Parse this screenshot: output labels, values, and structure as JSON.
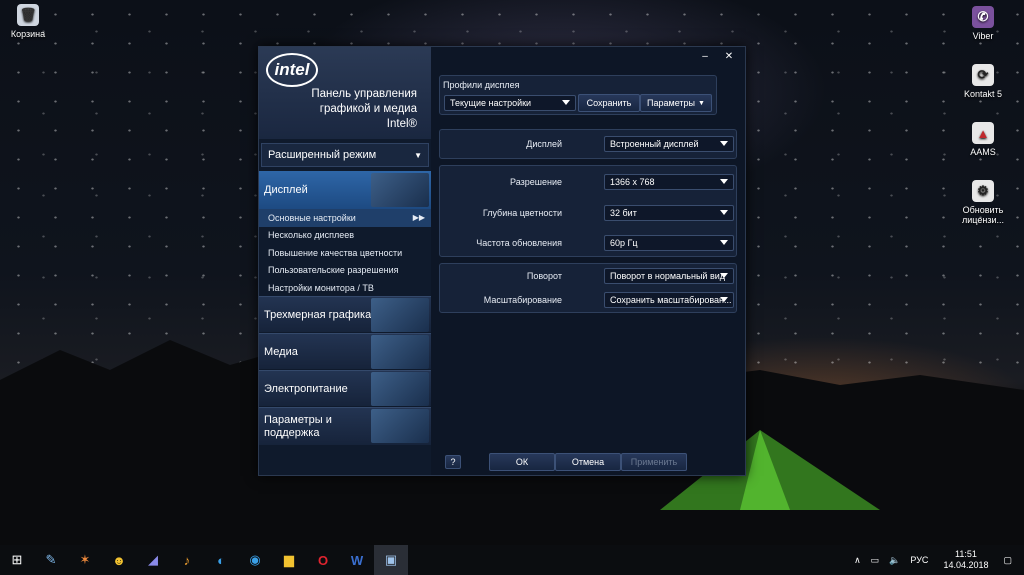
{
  "desktop": {
    "icons_left": [
      {
        "label": "Корзина",
        "icon": "recycle-bin-icon"
      }
    ],
    "icons_right": [
      {
        "label": "Viber",
        "icon": "viber-icon"
      },
      {
        "label": "Kontakt 5",
        "icon": "kontakt-icon"
      },
      {
        "label": "AAMS",
        "icon": "aams-icon"
      },
      {
        "label_line1": "Обновить",
        "label_line2": "лицензи...",
        "icon": "update-license-icon"
      }
    ]
  },
  "window": {
    "logo": "intel",
    "title_line1": "Панель управления",
    "title_line2": "графикой и медиа",
    "title_line3": "Intel®",
    "minimize": "–",
    "close": "✕"
  },
  "sidebar": {
    "mode_label": "Расширенный режим",
    "display": "Дисплей",
    "sub_items": [
      "Основные настройки",
      "Несколько дисплеев",
      "Повышение качества цветности",
      "Пользовательские разрешения",
      "Настройки монитора / ТВ"
    ],
    "sections": [
      "Трехмерная графика",
      "Медиа",
      "Электропитание"
    ],
    "support_line1": "Параметры и",
    "support_line2": "поддержка"
  },
  "profiles": {
    "heading": "Профили дисплея",
    "current": "Текущие настройки",
    "save": "Сохранить",
    "params": "Параметры"
  },
  "settings": {
    "display_label": "Дисплей",
    "display_value": "Встроенный дисплей",
    "resolution_label": "Разрешение",
    "resolution_value": "1366 x 768",
    "depth_label": "Глубина цветности",
    "depth_value": "32 бит",
    "refresh_label": "Частота обновления",
    "refresh_value": "60p Гц",
    "rotation_label": "Поворот",
    "rotation_value": "Поворот в нормальный вид",
    "scaling_label": "Масштабирование",
    "scaling_value": "Сохранить масштабирован..."
  },
  "footer": {
    "help": "?",
    "ok": "ОК",
    "cancel": "Отмена",
    "apply": "Применить"
  },
  "taskbar": {
    "apps": [
      "start-icon",
      "paint-icon",
      "fl-studio-icon",
      "daemon-tools-icon",
      "ableton-icon",
      "winamp-icon",
      "ccleaner-icon",
      "teamviewer-icon",
      "file-explorer-icon",
      "opera-icon",
      "word-icon",
      "intel-graphics-icon"
    ],
    "lang": "РУС",
    "time": "11:51",
    "date": "14.04.2018"
  }
}
